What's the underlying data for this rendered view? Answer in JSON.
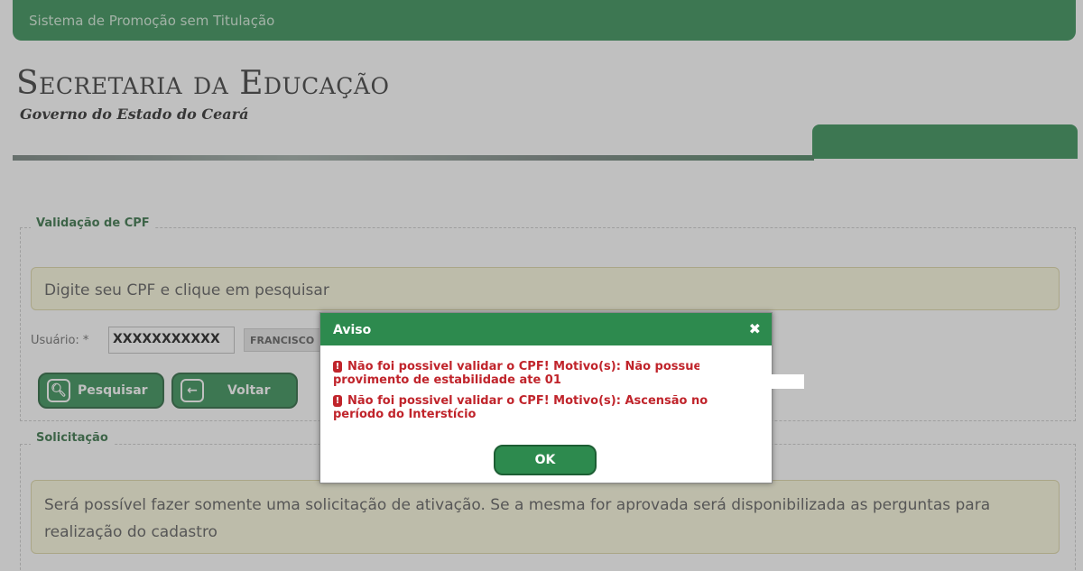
{
  "header": {
    "system_title": "Sistema de Promoção sem Titulação",
    "org_title": "Secretaria da Educação",
    "org_subtitle": "Governo do Estado do Ceará"
  },
  "cpf_section": {
    "legend": "Validação de CPF",
    "info": "Digite seu CPF e clique em pesquisar",
    "user_label": "Usuário: *",
    "cpf_value": "XXXXXXXXXXX",
    "name_value": "FRANCISCO",
    "search_label": "Pesquisar",
    "back_label": "Voltar"
  },
  "request_section": {
    "legend": "Solicitação",
    "info": "Será possível fazer somente uma solicitação de ativação. Se a mesma for aprovada será disponibilizada as perguntas para realização do cadastro"
  },
  "dialog": {
    "title": "Aviso",
    "close_icon": "close-icon",
    "messages": [
      "Não foi possivel validar o CPF! Motivo(s): Não possuem provimento de estabilidade ate 01",
      "Não foi possivel validar o CPF! Motivo(s): Ascensão no período do Interstício"
    ],
    "ok_label": "OK"
  },
  "colors": {
    "brand_green": "#2d8a4e",
    "error_red": "#c0242b",
    "info_bg": "#fbf8dc"
  }
}
